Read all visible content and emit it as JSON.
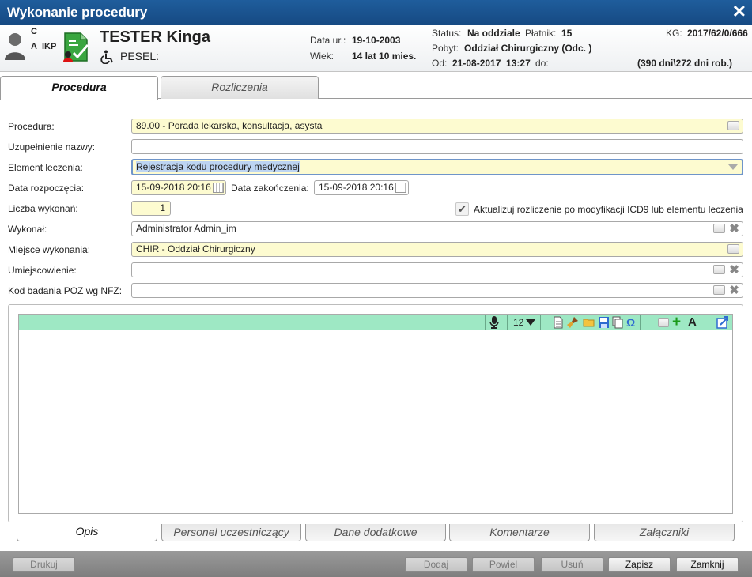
{
  "window": {
    "title": "Wykonanie procedury",
    "close_glyph": "✕"
  },
  "patient": {
    "flag_c": "C",
    "flag_a": "A",
    "flag_ikp": "IKP",
    "name": "TESTER Kinga",
    "pesel_label": "PESEL:",
    "birth_label": "Data ur.:",
    "birth_value": "19-10-2003",
    "age_label": "Wiek:",
    "age_value": "14 lat 10 mies.",
    "status_label": "Status:",
    "status_value": "Na oddziale",
    "payer_label": "Płatnik:",
    "payer_value": "15",
    "stay_label": "Pobyt:",
    "stay_value": "Oddział Chirurgiczny (Odc. )",
    "from_label": "Od:",
    "from_value": "21-08-2017  13:27",
    "to_label": "do:",
    "kg_label": "KG:",
    "kg_value": "2017/62/0/666",
    "days_value": "(390 dni\\272 dni rob.)"
  },
  "tabs_top": [
    {
      "label": "Procedura",
      "active": true
    },
    {
      "label": "Rozliczenia",
      "active": false
    }
  ],
  "form": {
    "procedura_label": "Procedura:",
    "procedura_value": "89.00 - Porada lekarska, konsultacja, asysta",
    "uzupelnienie_label": "Uzupełnienie nazwy:",
    "uzupelnienie_value": "",
    "element_label": "Element leczenia:",
    "element_value": "Rejestracja kodu procedury medycznej",
    "start_label": "Data rozpoczęcia:",
    "start_value": "15-09-2018 20:16",
    "end_label": "Data zakończenia:",
    "end_value": "15-09-2018 20:16",
    "count_label": "Liczba wykonań:",
    "count_value": "1",
    "update_checkbox_label": "Aktualizuj rozliczenie po modyfikacji ICD9 lub elementu leczenia",
    "update_checked": true,
    "wykonal_label": "Wykonał:",
    "wykonal_value": "Administrator Admin_im",
    "miejsce_label": "Miejsce wykonania:",
    "miejsce_value": "CHIR - Oddział Chirurgiczny",
    "umiejscowienie_label": "Umiejscowienie:",
    "umiejscowienie_value": "",
    "kod_poz_label": "Kod badania POZ wg NFZ:",
    "kod_poz_value": ""
  },
  "editor": {
    "font_size": "12",
    "toolbar_icons": [
      "microphone-icon",
      "new-document-icon",
      "clear-brush-icon",
      "open-folder-icon",
      "save-icon",
      "copy-icon",
      "omega-icon",
      "template-icon",
      "add-icon",
      "font-icon",
      "external-edit-icon"
    ],
    "content": ""
  },
  "tabs_bottom": [
    {
      "label": "Opis",
      "active": true
    },
    {
      "label": "Personel uczestniczący",
      "active": false
    },
    {
      "label": "Dane dodatkowe",
      "active": false
    },
    {
      "label": "Komentarze",
      "active": false
    },
    {
      "label": "Załączniki",
      "active": false
    }
  ],
  "footer": {
    "drukuj": "Drukuj",
    "dodaj": "Dodaj",
    "powiel": "Powiel",
    "usun": "Usuń",
    "zapisz": "Zapisz",
    "zamknij": "Zamknij"
  },
  "colors": {
    "title_bar": "#1f5d9c",
    "field_yellow": "#fdfbd0",
    "editor_toolbar": "#9ee8c4",
    "footer": "#8c8c8c"
  }
}
